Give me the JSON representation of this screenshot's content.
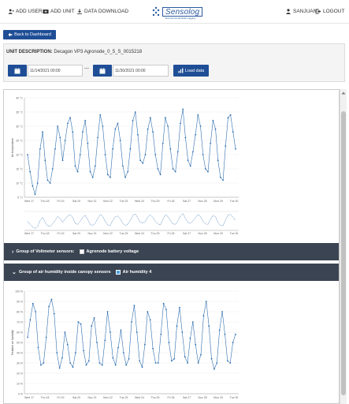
{
  "nav": {
    "add_user": "ADD USER",
    "add_unit": "ADD UNIT",
    "data_download": "DATA DOWNLOAD",
    "logo_text": "Sensolog",
    "logo_tagline": "Environmental Data Logging",
    "user": "SANJUAN",
    "logout": "LOGOUT"
  },
  "back_button": "Back to Dashboard",
  "unit": {
    "label": "UNIT DESCRIPTION:",
    "value": "Decagon VP3 Agronode_0_5_S_0015218"
  },
  "filter": {
    "start_date": "11/14/2021 00:00",
    "end_date": "11/30/2021 00:00",
    "separator": "—",
    "load_button": "Load data"
  },
  "groups": [
    {
      "label": "Group of Voltmeter sensors:",
      "sensor": "Agronode battery voltage",
      "checked": false,
      "expanded": false
    },
    {
      "label": "Group of air humidity inside canopy sensors",
      "sensor": "Air humidity 4",
      "checked": true,
      "expanded": true
    }
  ],
  "colors": {
    "series": "#2f6fb0",
    "accent": "#1f4e96",
    "group_bar": "#3a4452"
  },
  "chart_data": [
    {
      "type": "line",
      "ylabel": "Air temperature",
      "yticks": [
        "5 °C",
        "10 °C",
        "15 °C",
        "20 °C",
        "25 °C",
        "30 °C",
        "35 °C",
        "40 °C"
      ],
      "ylim": [
        5,
        40
      ],
      "xticks": [
        "Wed 17",
        "Thu 18",
        "Fri 19",
        "Sat 20",
        "Nov 21",
        "Mon 22",
        "Tue 23",
        "Wed 24",
        "Thu 25",
        "Fri 26",
        "Sat 27",
        "Nov 28",
        "Mon 29",
        "Tue 30"
      ],
      "series": [
        {
          "values": [
            20,
            14,
            9,
            6,
            10,
            22,
            28,
            18,
            11,
            10,
            15,
            22,
            30,
            26,
            18,
            25,
            31,
            33,
            28,
            16,
            14,
            20,
            28,
            32,
            24,
            14,
            12,
            16,
            26,
            34,
            30,
            20,
            13,
            12,
            22,
            29,
            31,
            25,
            16,
            12,
            14,
            22,
            32,
            35,
            27,
            18,
            17,
            20,
            29,
            33,
            28,
            20,
            15,
            13,
            24,
            33,
            30,
            22,
            15,
            14,
            21,
            31,
            36,
            26,
            18,
            16,
            21,
            27,
            34,
            30,
            20,
            15,
            14,
            24,
            32,
            29,
            18,
            12,
            11,
            23,
            33,
            34,
            28,
            22
          ]
        }
      ],
      "grid": true
    },
    {
      "type": "line",
      "ylabel": "Relative air humidity",
      "yticks": [
        "0 %",
        "10 %",
        "20 %",
        "30 %",
        "40 %",
        "50 %",
        "60 %",
        "70 %",
        "80 %",
        "90 %",
        "100 %"
      ],
      "ylim": [
        0,
        100
      ],
      "xticks": [
        "Wed 17",
        "Thu 18",
        "Fri 19",
        "Sat 20",
        "Nov 21",
        "Mon 22",
        "Tue 23",
        "Wed 24",
        "Thu 25",
        "Fri 26",
        "Sat 27",
        "Nov 28",
        "Mon 29",
        "Tue 30"
      ],
      "series": [
        {
          "values": [
            55,
            72,
            88,
            80,
            45,
            28,
            30,
            55,
            85,
            92,
            78,
            40,
            25,
            35,
            60,
            48,
            30,
            26,
            40,
            70,
            68,
            42,
            28,
            32,
            66,
            74,
            50,
            30,
            28,
            52,
            80,
            60,
            35,
            28,
            45,
            62,
            40,
            28,
            34,
            70,
            86,
            60,
            32,
            26,
            48,
            80,
            72,
            44,
            30,
            30,
            58,
            88,
            82,
            50,
            32,
            34,
            66,
            84,
            60,
            36,
            30,
            54,
            70,
            48,
            30,
            38,
            76,
            90,
            66,
            34,
            24,
            30,
            62,
            80,
            58,
            32,
            30,
            50,
            58
          ]
        }
      ],
      "grid": true
    }
  ]
}
